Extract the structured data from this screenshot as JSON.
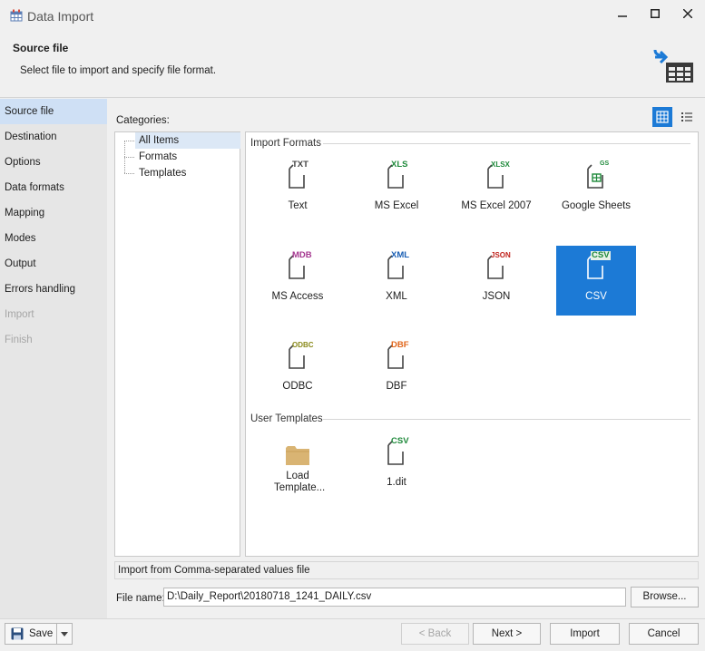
{
  "window": {
    "title": "Data Import",
    "controls": [
      "minimize-icon",
      "maximize-icon",
      "close-icon"
    ]
  },
  "header": {
    "title": "Source file",
    "subtitle": "Select file to import and specify file format."
  },
  "nav": {
    "items": [
      {
        "label": "Source file",
        "state": "active"
      },
      {
        "label": "Destination",
        "state": "normal"
      },
      {
        "label": "Options",
        "state": "normal"
      },
      {
        "label": "Data formats",
        "state": "normal"
      },
      {
        "label": "Mapping",
        "state": "normal"
      },
      {
        "label": "Modes",
        "state": "normal"
      },
      {
        "label": "Output",
        "state": "normal"
      },
      {
        "label": "Errors handling",
        "state": "normal"
      },
      {
        "label": "Import",
        "state": "disabled"
      },
      {
        "label": "Finish",
        "state": "disabled"
      }
    ]
  },
  "categories": {
    "label": "Categories:",
    "items": [
      {
        "label": "All Items",
        "selected": true
      },
      {
        "label": "Formats",
        "selected": false
      },
      {
        "label": "Templates",
        "selected": false
      }
    ]
  },
  "view_mode": "grid",
  "groups": {
    "import_formats": {
      "header": "Import Formats",
      "tiles": [
        {
          "badge": "TXT",
          "label": "Text",
          "color": "#444444"
        },
        {
          "badge": "XLS",
          "label": "MS Excel",
          "color": "#1f8a3b"
        },
        {
          "badge": "XLSX",
          "label": "MS Excel 2007",
          "color": "#1f8a3b"
        },
        {
          "badge": "GS",
          "label": "Google Sheets",
          "color": "#1f8a3b"
        },
        {
          "badge": "MDB",
          "label": "MS Access",
          "color": "#a4378f"
        },
        {
          "badge": "XML",
          "label": "XML",
          "color": "#1a5fb4"
        },
        {
          "badge": "JSON",
          "label": "JSON",
          "color": "#c0221c"
        },
        {
          "badge": "CSV",
          "label": "CSV",
          "color": "#1f8a3b",
          "selected": true
        },
        {
          "badge": "ODBC",
          "label": "ODBC",
          "color": "#8a8a1a"
        },
        {
          "badge": "DBF",
          "label": "DBF",
          "color": "#e0651a"
        }
      ]
    },
    "user_templates": {
      "header": "User Templates",
      "tiles": [
        {
          "badge": "",
          "label": "Load Template...",
          "icon": "folder-icon"
        },
        {
          "badge": "CSV",
          "label": "1.dit",
          "color": "#1f8a3b"
        }
      ]
    }
  },
  "status_text": "Import from Comma-separated values file",
  "file": {
    "label": "File name:",
    "value": "D:\\Daily_Report\\20180718_1241_DAILY.csv",
    "browse_label": "Browse..."
  },
  "footer": {
    "save_label": "Save",
    "back_label": "< Back",
    "next_label": "Next >",
    "import_label": "Import",
    "cancel_label": "Cancel"
  },
  "colors": {
    "accent": "#1c7ad6",
    "nav_active": "#cfe0f5"
  }
}
